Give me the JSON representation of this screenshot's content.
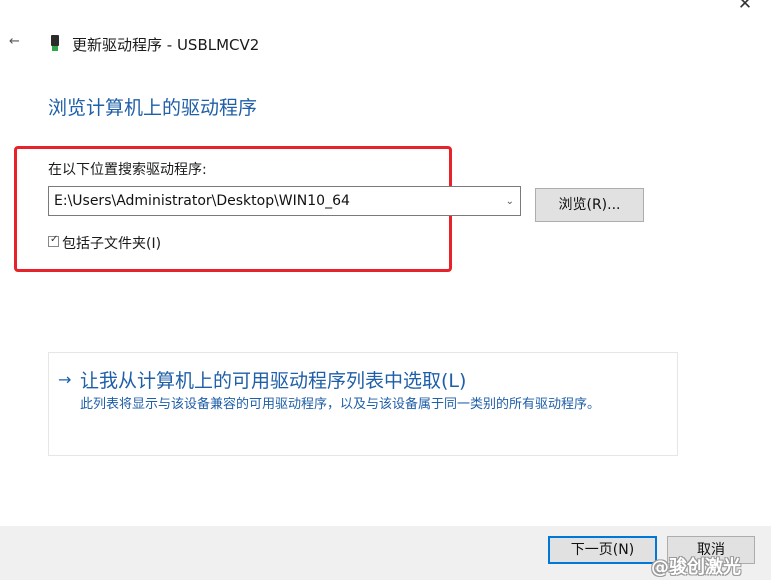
{
  "window": {
    "title": "更新驱动程序 - USBLMCV2",
    "back_glyph": "←",
    "close_glyph": "✕",
    "device_icon": "usb-device-icon"
  },
  "page": {
    "heading": "浏览计算机上的驱动程序"
  },
  "search": {
    "label": "在以下位置搜索驱动程序:",
    "path_value": "E:\\Users\\Administrator\\Desktop\\WIN10_64",
    "dropdown_glyph": "⌄",
    "browse_label": "浏览(R)...",
    "include_subfolders_label": "包括子文件夹(I)",
    "include_subfolders_checked": true,
    "check_glyph": "✓"
  },
  "pick_option": {
    "arrow_glyph": "→",
    "title": "让我从计算机上的可用驱动程序列表中选取(L)",
    "description": "此列表将显示与该设备兼容的可用驱动程序，以及与该设备属于同一类别的所有驱动程序。"
  },
  "footer": {
    "next_label": "下一页(N)",
    "cancel_label": "取消"
  },
  "watermark": {
    "text": "@骏创激光"
  },
  "colors": {
    "accent_blue": "#1f5fa8",
    "highlight_red": "#e8222a",
    "focus_blue": "#0078d7",
    "footer_bg": "#f0f0f0"
  }
}
